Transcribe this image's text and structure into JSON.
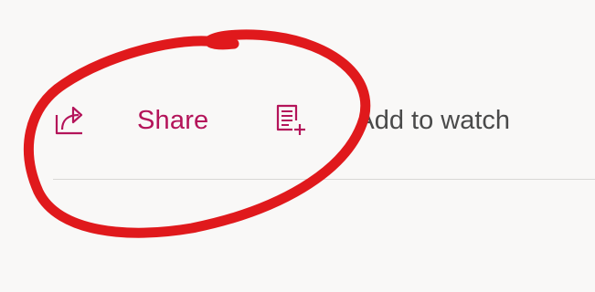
{
  "actions": {
    "share_label": "Share",
    "watchlist_label": "Add to watch"
  },
  "icons": {
    "share": "share-icon",
    "watchlist": "add-to-watchlist-icon"
  },
  "colors": {
    "accent": "#b4145a",
    "text": "#4a4a4a",
    "annotation": "#e0191c",
    "background": "#f9f8f7",
    "divider": "#d9d8d6"
  }
}
